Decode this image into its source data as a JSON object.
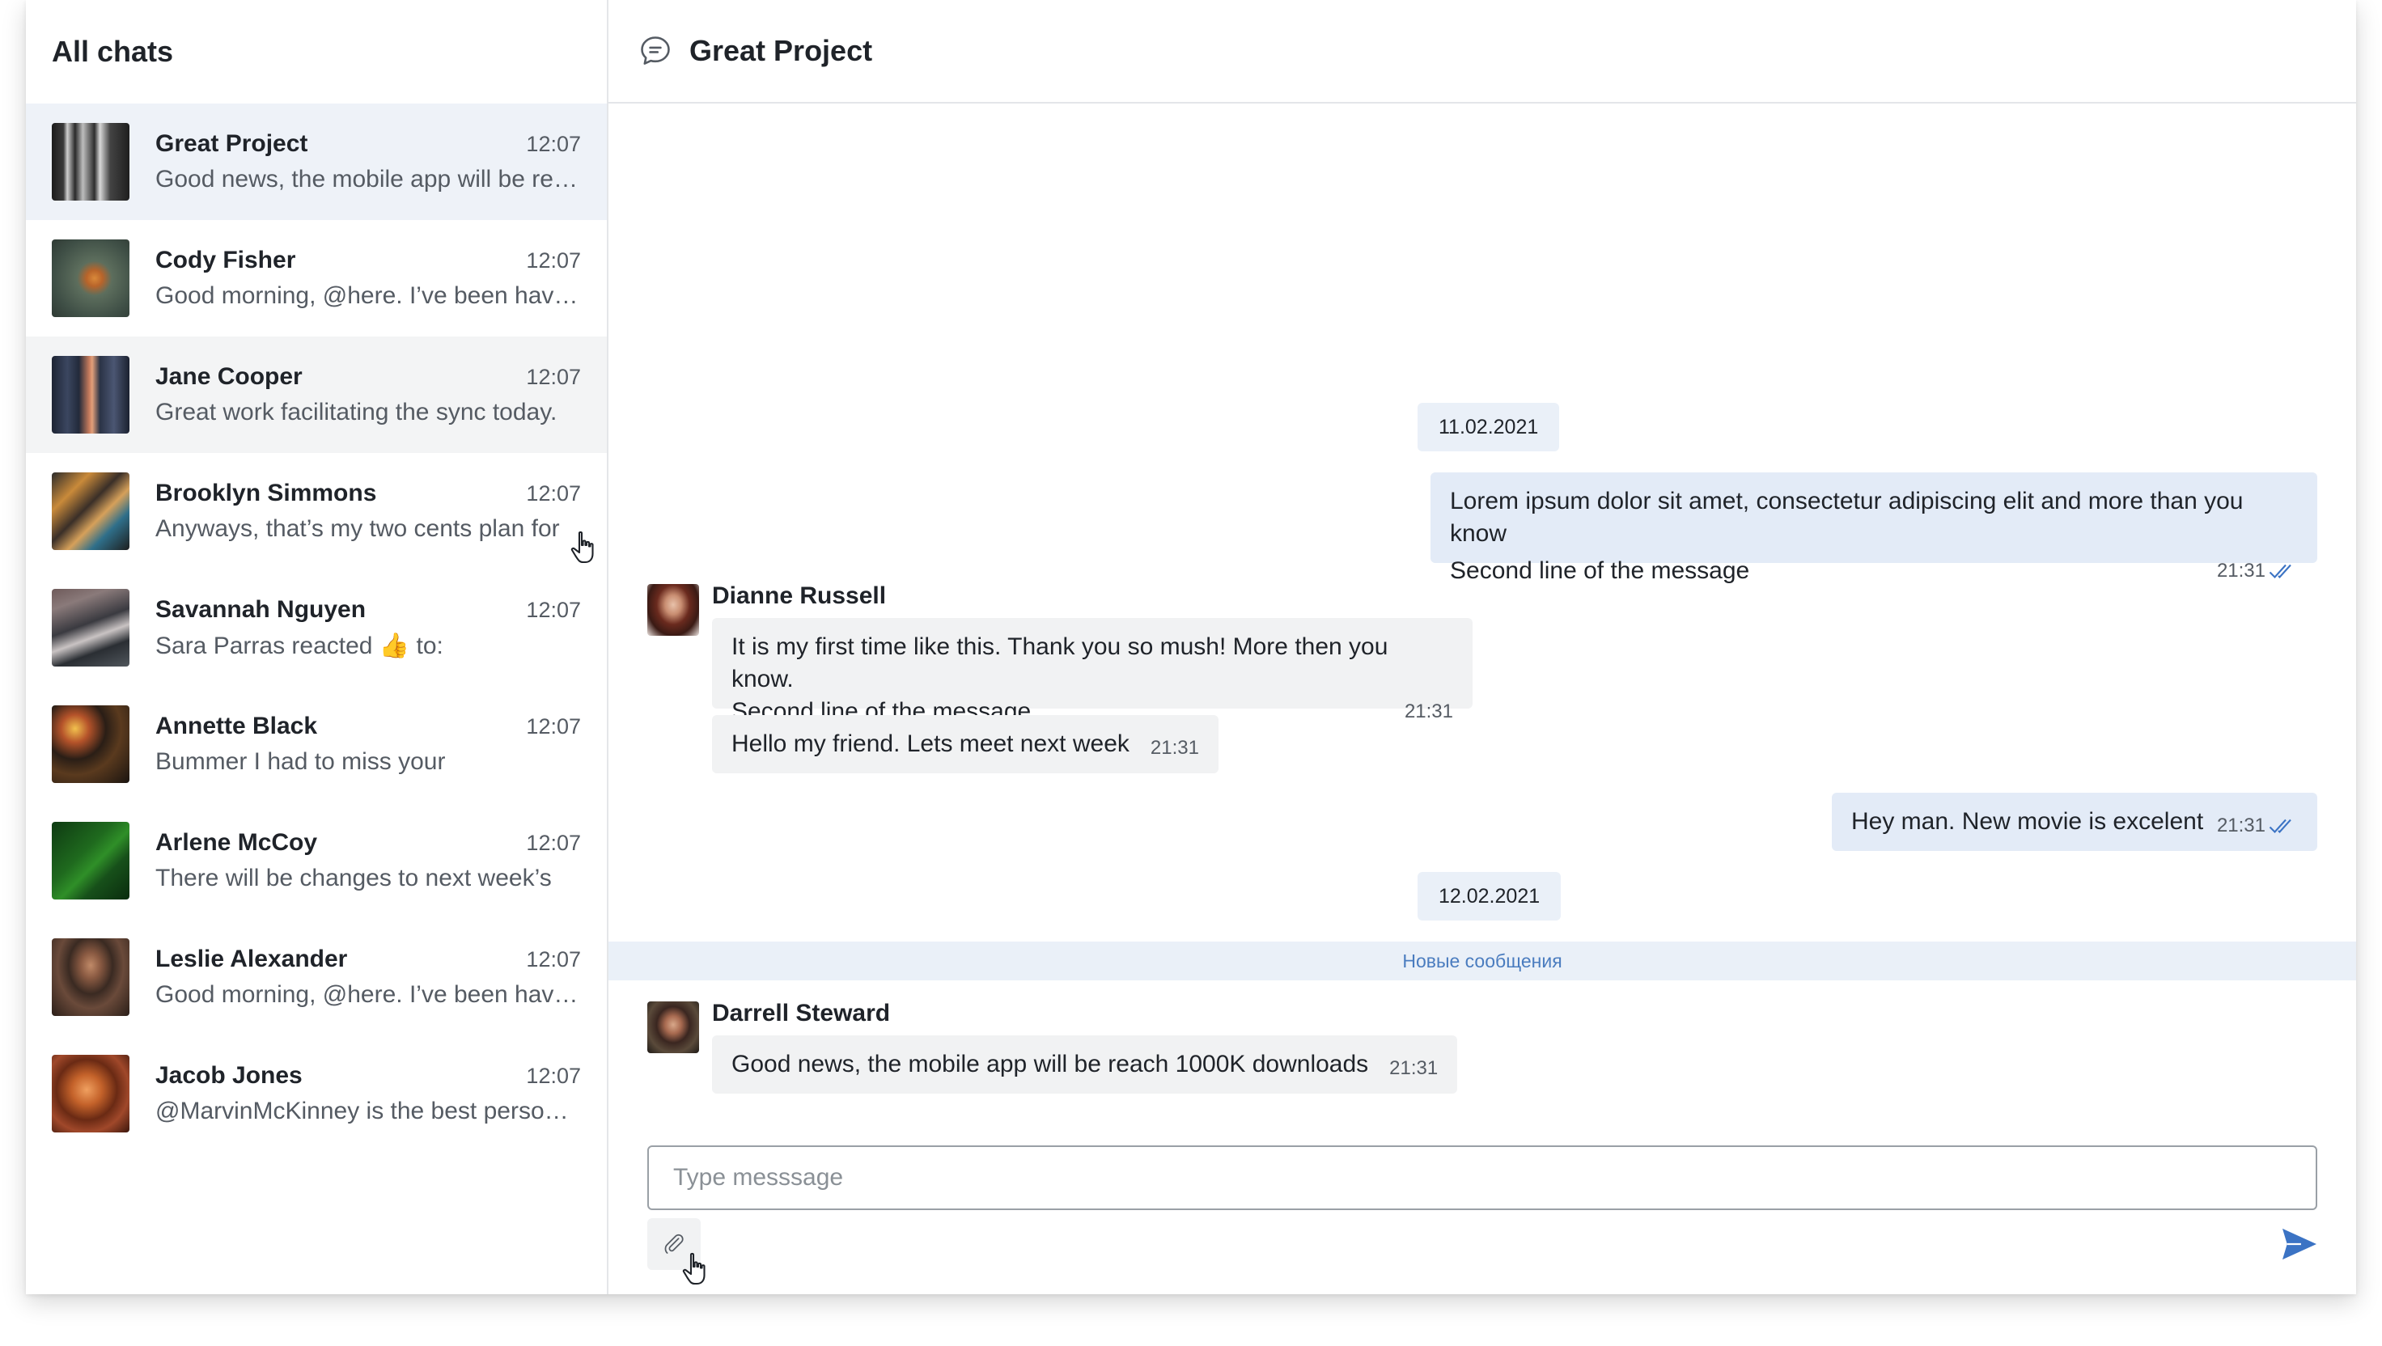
{
  "sidebar": {
    "title": "All chats",
    "chats": [
      {
        "name": "Great Project",
        "time": "12:07",
        "preview": "Good news, the mobile app will be rea..."
      },
      {
        "name": "Cody Fisher",
        "time": "12:07",
        "preview": "Good morning, @here. I’ve been having"
      },
      {
        "name": "Jane Cooper",
        "time": "12:07",
        "preview": "Great work facilitating the sync today."
      },
      {
        "name": "Brooklyn Simmons",
        "time": "12:07",
        "preview": "Anyways, that’s my two cents plan for"
      },
      {
        "name": "Savannah Nguyen",
        "time": "12:07",
        "preview": "Sara Parras reacted 👍 to:"
      },
      {
        "name": "Annette Black",
        "time": "12:07",
        "preview": "Bummer I had to miss your"
      },
      {
        "name": "Arlene McCoy",
        "time": "12:07",
        "preview": "There will be changes to next week’s"
      },
      {
        "name": "Leslie Alexander",
        "time": "12:07",
        "preview": "Good morning, @here. I’ve been having"
      },
      {
        "name": "Jacob Jones",
        "time": "12:07",
        "preview": "@MarvinMcKinney is the best person to"
      }
    ]
  },
  "header": {
    "title": "Great Project",
    "icon": "chat-bubble-icon"
  },
  "conversation": {
    "date_1": "11.02.2021",
    "msg_out_1": {
      "line1": "Lorem ipsum dolor sit amet, consectetur adipiscing elit and more than you know",
      "line2": "Second line of the message",
      "time": "21:31"
    },
    "sender_1": "Dianne Russell",
    "msg_in_1": {
      "line1": "It is my first time like this. Thank you so mush! More then you know.",
      "line2": "Second line of the message",
      "time": "21:31"
    },
    "msg_in_2": {
      "text": "Hello my friend. Lets meet next week",
      "time": "21:31"
    },
    "msg_out_2": {
      "text": "Hey man. New movie is excelent",
      "time": "21:31"
    },
    "date_2": "12.02.2021",
    "new_messages_label": "Новые сообщения",
    "sender_2": "Darrell Steward",
    "msg_in_3": {
      "text": "Good news, the mobile app will be reach 1000K downloads",
      "time": "21:31"
    }
  },
  "composer": {
    "placeholder": "Type messsage",
    "attach_icon": "paperclip-icon",
    "send_icon": "send-icon"
  },
  "colors": {
    "active_chat_bg": "#eef2f8",
    "outgoing_bubble": "#e3ebf7",
    "incoming_bubble": "#f1f2f3",
    "accent": "#3b73c4"
  }
}
